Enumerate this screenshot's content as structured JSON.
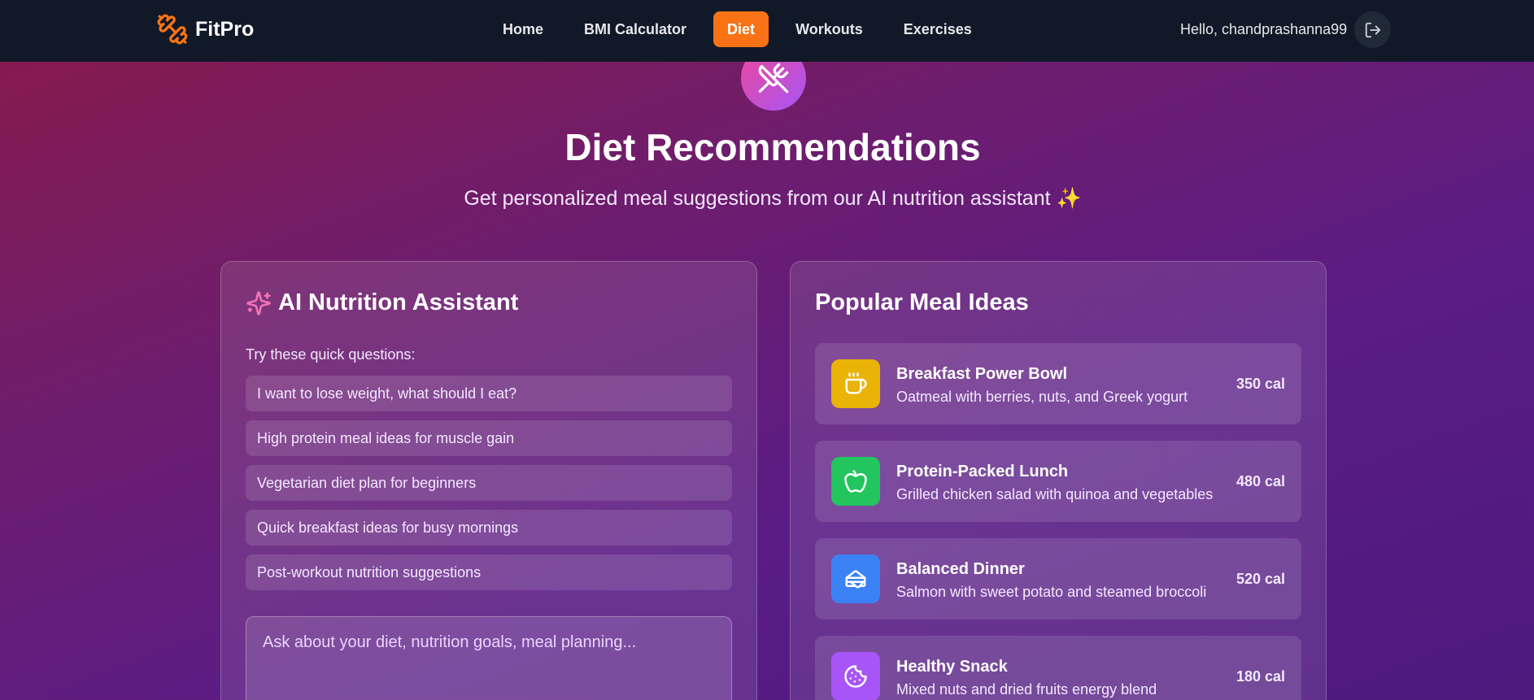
{
  "nav": {
    "brand": "FitPro",
    "links": [
      {
        "label": "Home"
      },
      {
        "label": "BMI Calculator"
      },
      {
        "label": "Diet"
      },
      {
        "label": "Workouts"
      },
      {
        "label": "Exercises"
      }
    ],
    "active_link": "Diet",
    "greeting": "Hello, chandprashanna99",
    "logout_icon": "logout-icon"
  },
  "hero": {
    "icon": "fork-knife-icon",
    "title": "Diet Recommendations",
    "subtitle": "Get personalized meal suggestions from our AI nutrition assistant ✨"
  },
  "assistant": {
    "title": "AI Nutrition Assistant",
    "icon": "sparkles-icon",
    "quick_label": "Try these quick questions:",
    "questions": [
      "I want to lose weight, what should I eat?",
      "High protein meal ideas for muscle gain",
      "Vegetarian diet plan for beginners",
      "Quick breakfast ideas for busy mornings",
      "Post-workout nutrition suggestions"
    ],
    "input_placeholder": "Ask about your diet, nutrition goals, meal planning..."
  },
  "meals": {
    "title": "Popular Meal Ideas",
    "items": [
      {
        "name": "Breakfast Power Bowl",
        "desc": "Oatmeal with berries, nuts, and Greek yogurt",
        "cal": "350 cal",
        "icon": "coffee-icon",
        "color": "#eab308"
      },
      {
        "name": "Protein-Packed Lunch",
        "desc": "Grilled chicken salad with quinoa and vegetables",
        "cal": "480 cal",
        "icon": "apple-icon",
        "color": "#22c55e"
      },
      {
        "name": "Balanced Dinner",
        "desc": "Salmon with sweet potato and steamed broccoli",
        "cal": "520 cal",
        "icon": "sandwich-icon",
        "color": "#3b82f6"
      },
      {
        "name": "Healthy Snack",
        "desc": "Mixed nuts and dried fruits energy blend",
        "cal": "180 cal",
        "icon": "cookie-icon",
        "color": "#a855f7"
      }
    ]
  },
  "colors": {
    "nav_bg": "#111827",
    "accent": "#f97316"
  }
}
